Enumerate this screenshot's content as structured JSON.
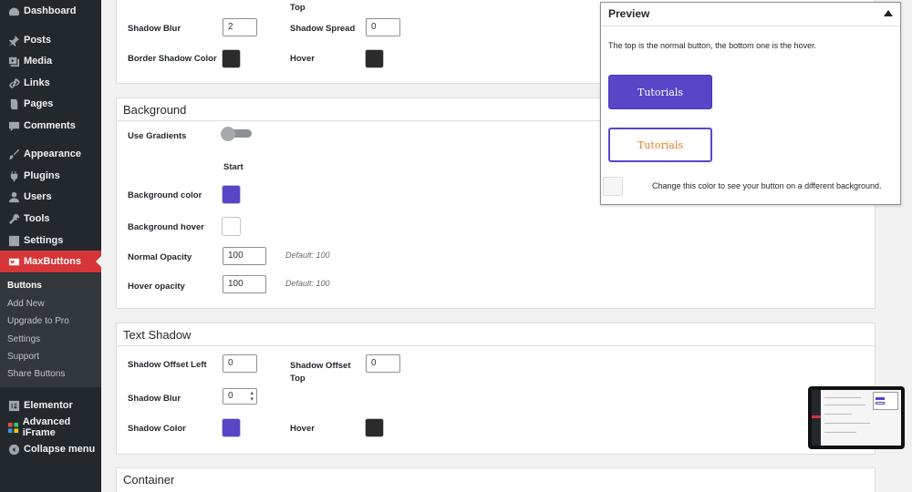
{
  "sidebar": {
    "items": [
      {
        "label": "Dashboard",
        "icon": "dashboard-icon"
      },
      {
        "label": "Posts",
        "icon": "pin-icon"
      },
      {
        "label": "Media",
        "icon": "media-icon"
      },
      {
        "label": "Links",
        "icon": "link-icon"
      },
      {
        "label": "Pages",
        "icon": "pages-icon"
      },
      {
        "label": "Comments",
        "icon": "comment-icon"
      },
      {
        "label": "Appearance",
        "icon": "brush-icon"
      },
      {
        "label": "Plugins",
        "icon": "plugin-icon"
      },
      {
        "label": "Users",
        "icon": "user-icon"
      },
      {
        "label": "Tools",
        "icon": "wrench-icon"
      },
      {
        "label": "Settings",
        "icon": "settings-icon"
      },
      {
        "label": "MaxButtons",
        "icon": "maxbuttons-icon"
      },
      {
        "label": "Elementor",
        "icon": "elementor-icon"
      },
      {
        "label": "Advanced iFrame",
        "icon": "iframe-icon"
      },
      {
        "label": "Collapse menu",
        "icon": "collapse-icon"
      }
    ],
    "submenu": [
      "Buttons",
      "Add New",
      "Upgrade to Pro",
      "Settings",
      "Support",
      "Share Buttons"
    ]
  },
  "border_shadow": {
    "shadow_offset_top_label": "Top",
    "shadow_blur_label": "Shadow Blur",
    "shadow_blur_value": "2",
    "shadow_spread_label": "Shadow Spread",
    "shadow_spread_value": "0",
    "border_shadow_color_label": "Border Shadow Color",
    "hover_label": "Hover",
    "color": "#2b2b2b",
    "hover_color": "#2b2b2b"
  },
  "background": {
    "title": "Background",
    "use_gradients_label": "Use Gradients",
    "use_gradients": false,
    "start_label": "Start",
    "color_label": "Background color",
    "color": "#5746c8",
    "hover_label": "Background hover",
    "hover_color": "#ffffff",
    "normal_opacity_label": "Normal Opacity",
    "normal_opacity_value": "100",
    "normal_opacity_hint": "Default: 100",
    "hover_opacity_label": "Hover opacity",
    "hover_opacity_value": "100",
    "hover_opacity_hint": "Default: 100"
  },
  "text_shadow": {
    "title": "Text Shadow",
    "offset_left_label": "Shadow Offset Left",
    "offset_left_value": "0",
    "offset_top_label": "Shadow Offset Top",
    "offset_top_value": "0",
    "blur_label": "Shadow Blur",
    "blur_value": "0",
    "color_label": "Shadow Color",
    "color": "#5746c8",
    "hover_label": "Hover",
    "hover_color": "#2b2b2b"
  },
  "container": {
    "title": "Container"
  },
  "preview": {
    "title": "Preview",
    "description": "The top is the normal button, the bottom one is the hover.",
    "normal_button_text": "Tutorials",
    "hover_button_text": "Tutorials",
    "bg_note": "Change this color to see your button on a different background."
  }
}
